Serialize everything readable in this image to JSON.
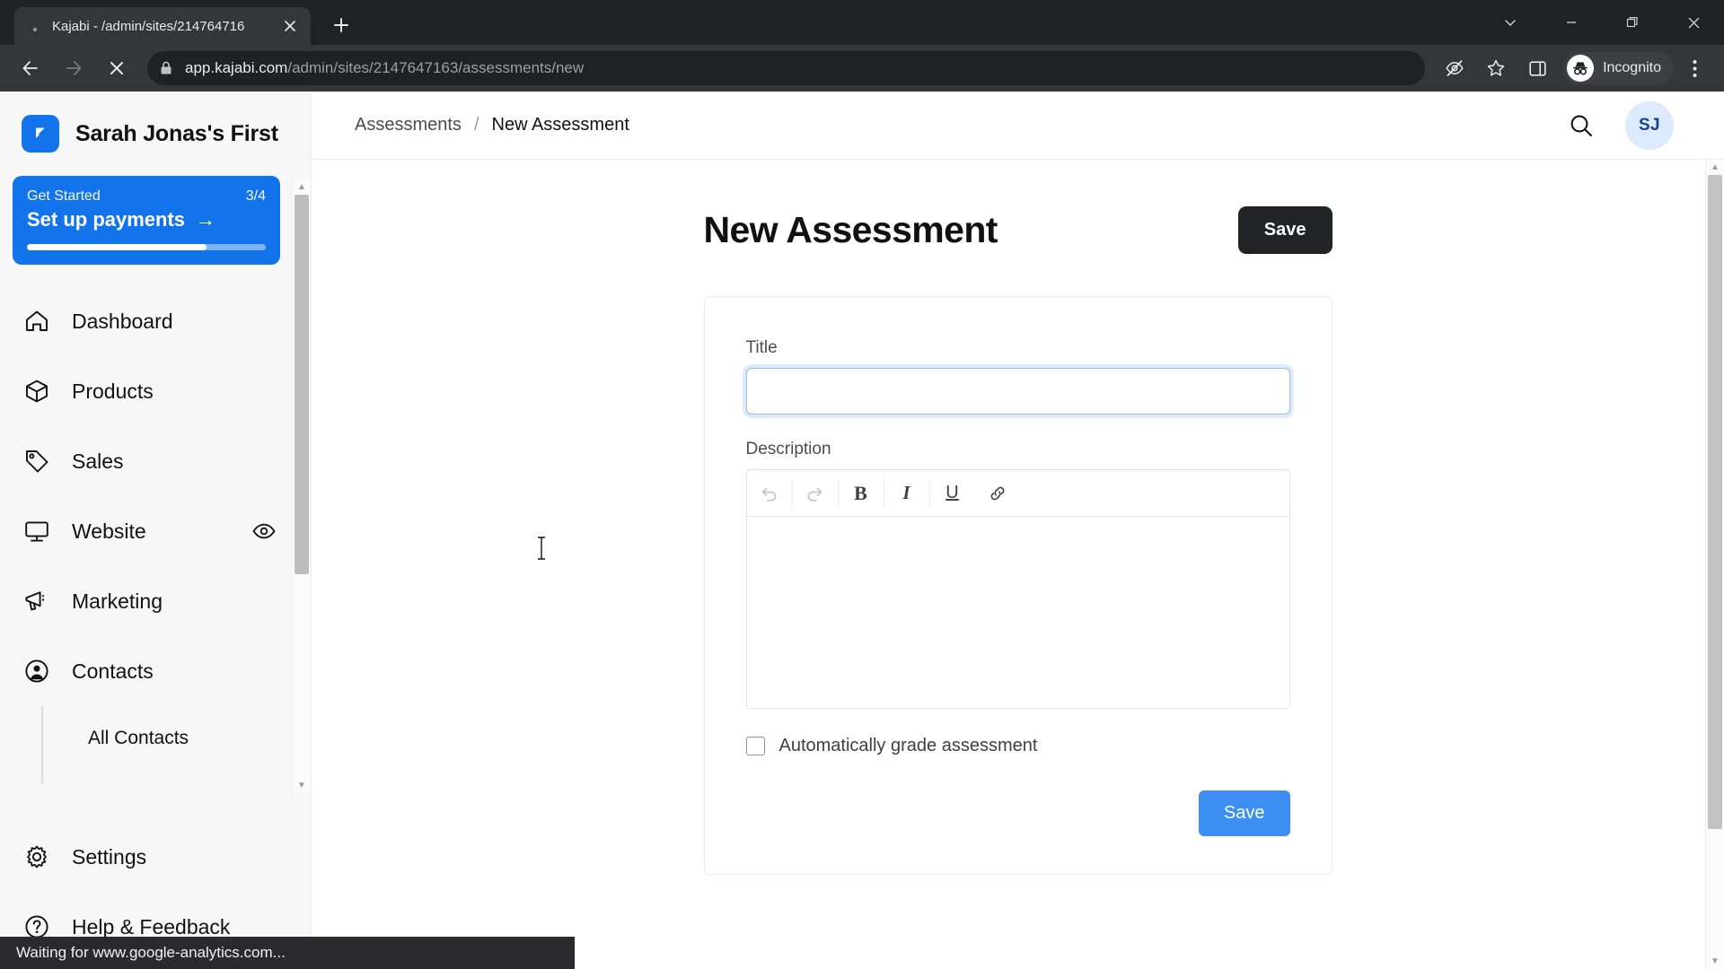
{
  "browser": {
    "tab": {
      "title": "Kajabi - /admin/sites/214764716",
      "favicon_icon": "dot-favicon",
      "close_icon": "close-icon"
    },
    "new_tab_icon": "plus-icon",
    "window_controls": [
      {
        "name": "tab-search",
        "icon": "chevron-down-icon"
      },
      {
        "name": "minimize",
        "icon": "minimize-icon"
      },
      {
        "name": "maximize",
        "icon": "restore-icon"
      },
      {
        "name": "close",
        "icon": "close-icon"
      }
    ],
    "nav": {
      "back_icon": "arrow-left-icon",
      "forward_icon": "arrow-right-icon",
      "stop_icon": "close-icon"
    },
    "omnibox": {
      "lock_icon": "lock-icon",
      "host": "app.kajabi.com",
      "path": "/admin/sites/2147647163/assessments/new"
    },
    "toolbar_icons": [
      {
        "name": "third-party-cookie-blocked-icon",
        "icon": "eye-slash-icon"
      },
      {
        "name": "bookmark-icon",
        "icon": "star-icon"
      },
      {
        "name": "side-panel-icon",
        "icon": "panel-icon"
      }
    ],
    "incognito_label": "Incognito",
    "menu_icon": "three-dots-icon",
    "status_text": "Waiting for www.google-analytics.com..."
  },
  "sidebar": {
    "brand_name": "Sarah Jonas's First",
    "brand_logo_icon": "kajabi-logo-icon",
    "get_started": {
      "label": "Get Started",
      "count": "3/4",
      "action": "Set up payments",
      "arrow_icon": "arrow-right-icon",
      "progress_percent": 75
    },
    "items": [
      {
        "label": "Dashboard",
        "icon": "home-icon"
      },
      {
        "label": "Products",
        "icon": "box-icon"
      },
      {
        "label": "Sales",
        "icon": "tag-icon"
      },
      {
        "label": "Website",
        "icon": "monitor-icon",
        "trailing_icon": "eye-icon"
      },
      {
        "label": "Marketing",
        "icon": "megaphone-icon"
      },
      {
        "label": "Contacts",
        "icon": "person-circle-icon"
      }
    ],
    "subitems": [
      {
        "label": "All Contacts"
      }
    ],
    "bottom_items": [
      {
        "label": "Settings",
        "icon": "gear-icon"
      },
      {
        "label": "Help & Feedback",
        "icon": "question-circle-icon"
      }
    ]
  },
  "topbar": {
    "breadcrumb": {
      "parent": "Assessments",
      "separator": "/",
      "current": "New Assessment"
    },
    "search_icon": "search-icon",
    "avatar_initials": "SJ"
  },
  "page": {
    "title": "New Assessment",
    "save_top_label": "Save",
    "form": {
      "title_label": "Title",
      "title_value": "",
      "title_placeholder": "",
      "description_label": "Description",
      "description_value": "",
      "editor_buttons": [
        {
          "name": "undo-button",
          "icon": "undo-icon",
          "glyph": "↶",
          "disabled": true
        },
        {
          "name": "redo-button",
          "icon": "redo-icon",
          "glyph": "↷",
          "disabled": true
        },
        {
          "name": "bold-button",
          "icon": "bold-icon",
          "glyph": "B",
          "disabled": false
        },
        {
          "name": "italic-button",
          "icon": "italic-icon",
          "glyph": "I",
          "disabled": false
        },
        {
          "name": "underline-button",
          "icon": "underline-icon",
          "glyph": "U",
          "disabled": false
        },
        {
          "name": "link-button",
          "icon": "link-icon",
          "glyph": "⚭",
          "disabled": false
        }
      ],
      "auto_grade_label": "Automatically grade assessment",
      "auto_grade_checked": false,
      "save_bottom_label": "Save"
    }
  },
  "colors": {
    "brand_blue": "#1273ea",
    "accent_blue": "#3c8ef2",
    "dark_button": "#222326",
    "avatar_bg": "#dcebfb",
    "avatar_text": "#15458f"
  }
}
